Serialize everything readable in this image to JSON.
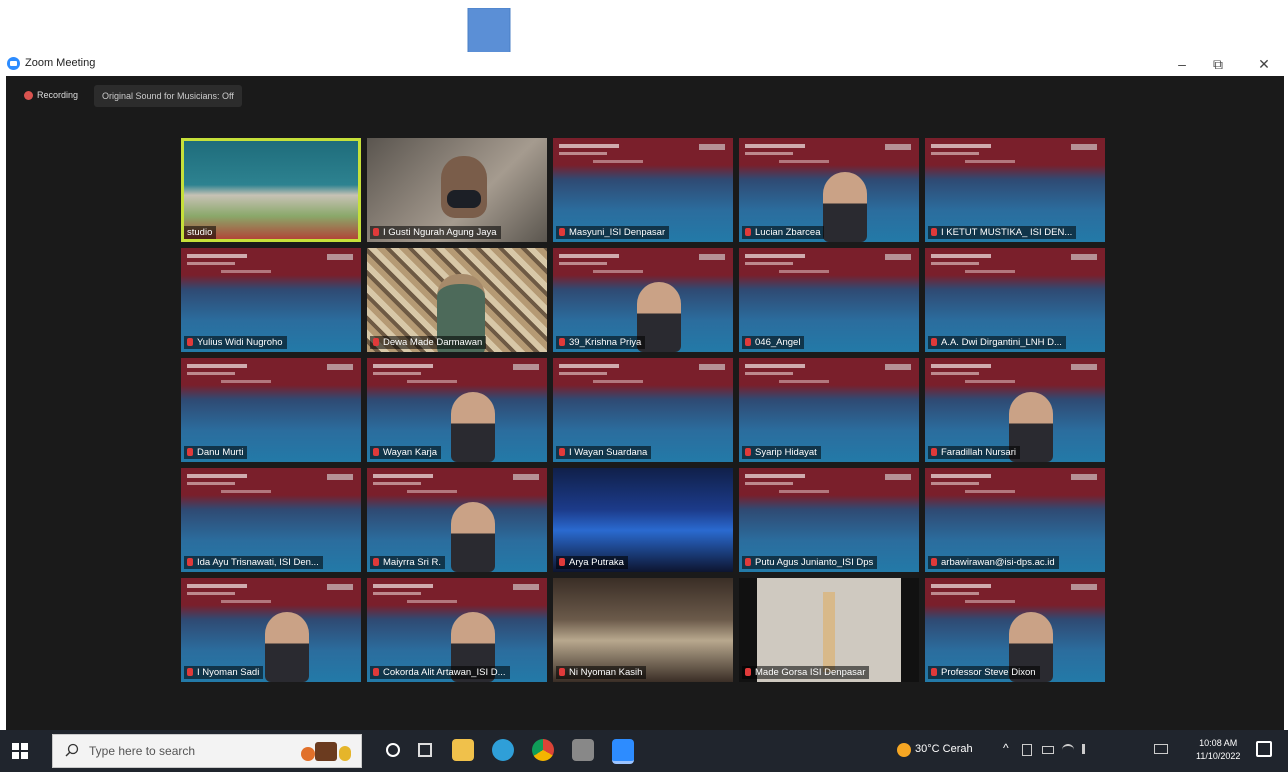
{
  "window": {
    "title": "Zoom Meeting"
  },
  "window_controls": {
    "minimize": "–",
    "maximize": "⧉",
    "close": "✕"
  },
  "toolbar": {
    "recording_label": "Recording",
    "original_sound_label": "Original Sound for Musicians: Off"
  },
  "participants": [
    {
      "name": "studio",
      "kind": "studio"
    },
    {
      "name": "I Gusti Ngurah Agung Jaya",
      "kind": "camera"
    },
    {
      "name": "Masyuni_ISI Denpasar",
      "kind": "banner"
    },
    {
      "name": "Lucian Zbarcea",
      "kind": "banner-person"
    },
    {
      "name": "I KETUT MUSTIKA_ ISI DEN...",
      "kind": "banner"
    },
    {
      "name": "Yulius Widi Nugroho",
      "kind": "banner"
    },
    {
      "name": "Dewa Made Darmawan",
      "kind": "camera-batik"
    },
    {
      "name": "39_Krishna Priya",
      "kind": "banner-person"
    },
    {
      "name": "046_Angel",
      "kind": "banner"
    },
    {
      "name": "A.A. Dwi Dirgantini_LNH D...",
      "kind": "banner"
    },
    {
      "name": "Danu Murti",
      "kind": "banner"
    },
    {
      "name": "Wayan Karja",
      "kind": "banner-person"
    },
    {
      "name": "I Wayan Suardana",
      "kind": "banner"
    },
    {
      "name": "Syarip Hidayat",
      "kind": "banner"
    },
    {
      "name": "Faradillah Nursari",
      "kind": "banner-person"
    },
    {
      "name": "Ida Ayu Trisnawati, ISI Den...",
      "kind": "banner"
    },
    {
      "name": "Maiyrra Sri R.",
      "kind": "banner-person"
    },
    {
      "name": "Arya Putraka",
      "kind": "camera-stage"
    },
    {
      "name": "Putu Agus Junianto_ISI Dps",
      "kind": "banner"
    },
    {
      "name": "arbawirawan@isi-dps.ac.id",
      "kind": "banner"
    },
    {
      "name": "I Nyoman Sadi",
      "kind": "banner-person"
    },
    {
      "name": "Cokorda Alit Artawan_ISI D...",
      "kind": "banner-person"
    },
    {
      "name": "Ni Nyoman Kasih",
      "kind": "camera-room"
    },
    {
      "name": "Made Gorsa ISI Denpasar",
      "kind": "camera-hall"
    },
    {
      "name": "Professor Steve Dixon",
      "kind": "banner-person"
    }
  ],
  "taskbar": {
    "search_placeholder": "Type here to search",
    "weather": "30°C  Cerah",
    "time": "10:08 AM",
    "date": "11/10/2022"
  },
  "colors": {
    "accent_active_speaker": "#c6e03a",
    "banner_red": "#7a1f2b",
    "banner_blue": "#2b6d9e",
    "zoom_blue": "#2d8cff"
  }
}
